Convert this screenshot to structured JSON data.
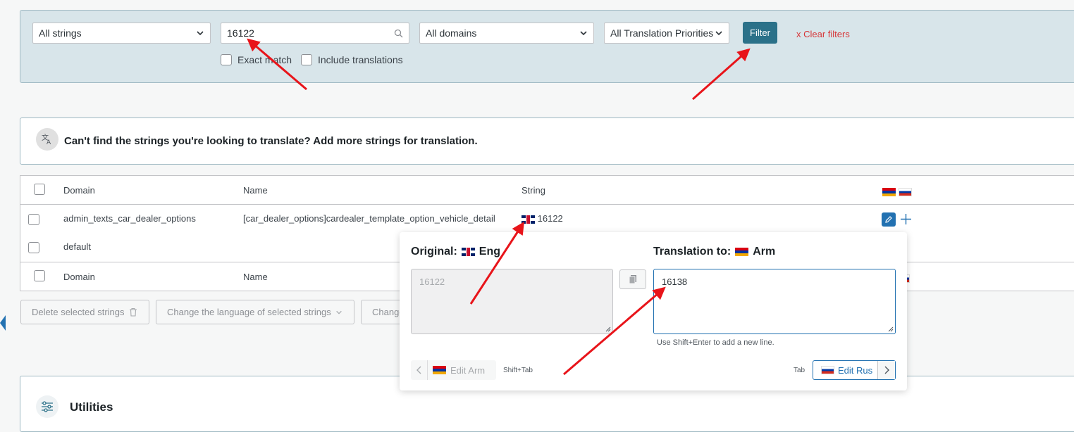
{
  "filters": {
    "strings_select": "All strings",
    "search_value": "16122",
    "domains_select": "All domains",
    "priorities_select": "All Translation Priorities",
    "filter_label": "Filter",
    "clear_label": "x  Clear filters",
    "exact_match_label": "Exact match",
    "include_translations_label": "Include translations"
  },
  "info": {
    "text": "Can't find the strings you're looking to translate? Add more strings for translation."
  },
  "table": {
    "header": {
      "domain": "Domain",
      "name": "Name",
      "string": "String"
    },
    "rows": [
      {
        "domain": "admin_texts_car_dealer_options",
        "name": "[car_dealer_options]cardealer_template_option_vehicle_detail",
        "string": "16122"
      },
      {
        "domain": "default",
        "name": "",
        "string": ""
      }
    ],
    "footer": {
      "domain": "Domain",
      "name": "Name"
    }
  },
  "bulk_actions": {
    "delete": "Delete selected strings",
    "change_language": "Change the language of selected strings",
    "change_other": "Change"
  },
  "utilities": {
    "title": "Utilities"
  },
  "popup": {
    "original_label": "Original:",
    "original_lang": "Eng",
    "translation_label": "Translation to:",
    "translation_lang": "Arm",
    "original_value": "16122",
    "translation_value": "16138",
    "hint": "Use Shift+Enter to add a new line.",
    "prev_label": "Edit Arm",
    "prev_shortcut": "Shift+Tab",
    "next_label": "Edit Rus",
    "next_shortcut": "Tab"
  },
  "colors": {
    "filter_bg": "#d8e5ea",
    "primary_button": "#2b7189",
    "clear_link": "#d63638",
    "annotation_arrow": "#e8141a"
  },
  "icons": [
    "chevron-down-icon",
    "search-icon",
    "translate-icon",
    "trash-icon",
    "pencil-icon",
    "plus-icon",
    "copy-icon",
    "sliders-icon",
    "chevron-left-icon",
    "chevron-right-icon"
  ]
}
